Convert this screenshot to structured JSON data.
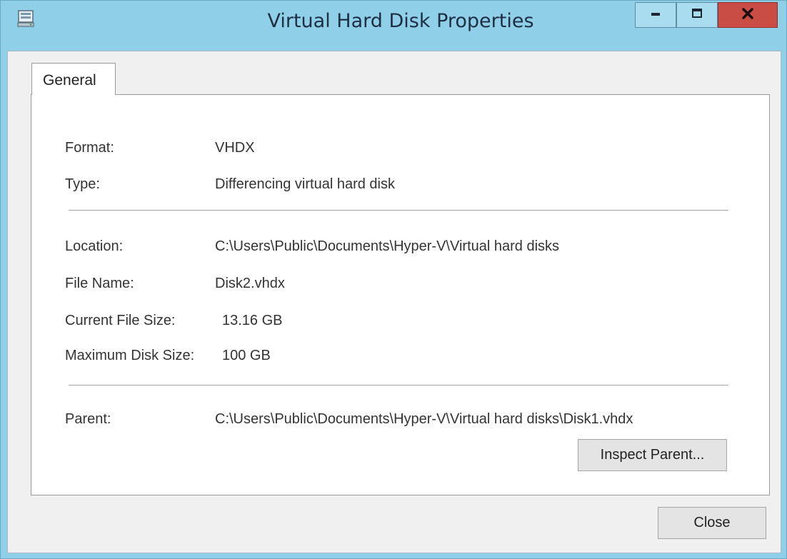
{
  "window": {
    "title": "Virtual Hard Disk Properties",
    "icon": "disk-properties-icon",
    "controls": {
      "minimize_icon": "minimize-icon",
      "maximize_icon": "maximize-icon",
      "close_icon": "close-icon"
    }
  },
  "tabs": [
    {
      "label": "General",
      "selected": true
    }
  ],
  "general": {
    "format": {
      "label": "Format:",
      "value": "VHDX"
    },
    "type": {
      "label": "Type:",
      "value": "Differencing virtual hard disk"
    },
    "location": {
      "label": "Location:",
      "value": "C:\\Users\\Public\\Documents\\Hyper-V\\Virtual hard disks"
    },
    "file_name": {
      "label": "File Name:",
      "value": "Disk2.vhdx"
    },
    "current_size": {
      "label": "Current File Size:",
      "value": "13.16 GB"
    },
    "max_size": {
      "label": "Maximum Disk Size:",
      "value": "100 GB"
    },
    "parent": {
      "label": "Parent:",
      "value": "C:\\Users\\Public\\Documents\\Hyper-V\\Virtual hard disks\\Disk1.vhdx"
    },
    "inspect_parent_label": "Inspect Parent..."
  },
  "footer": {
    "close_label": "Close"
  },
  "colors": {
    "titlebar": "#8fcfe8",
    "close_button": "#c94c45",
    "dialog_background": "#f0f0f0",
    "panel_background": "#ffffff"
  }
}
